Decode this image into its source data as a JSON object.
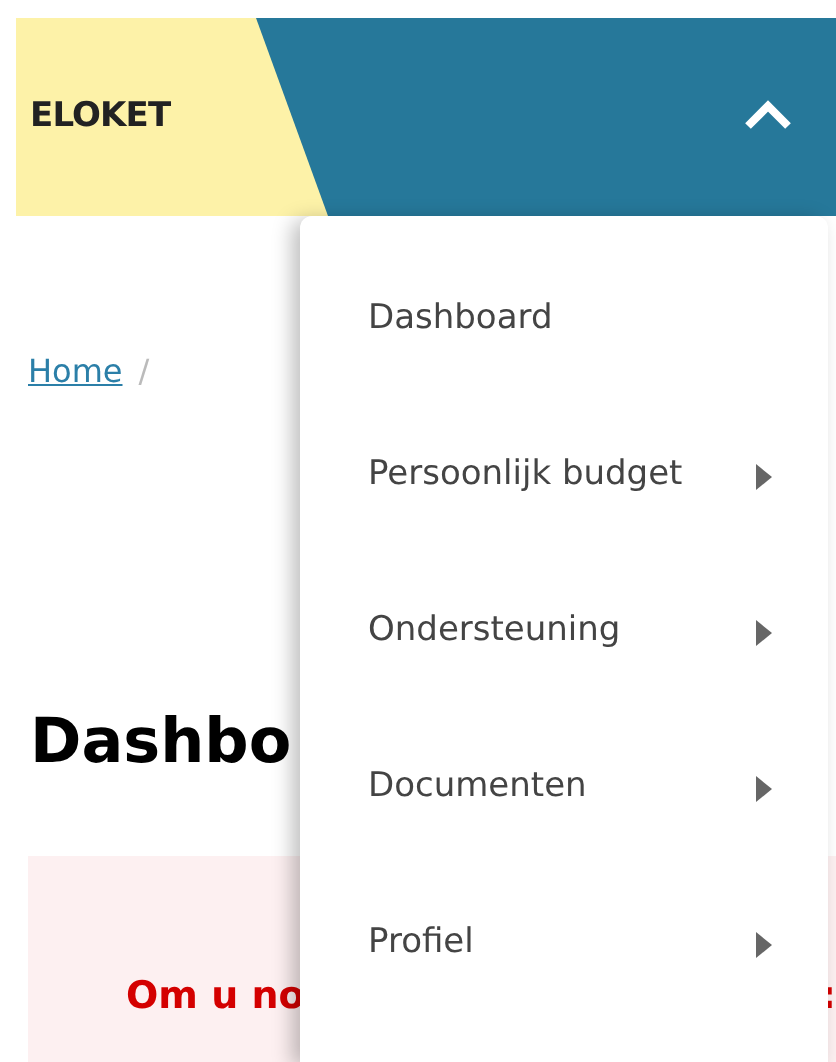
{
  "header": {
    "logo": "ELOKET",
    "menu_expanded": true
  },
  "breadcrumb": {
    "home": "Home",
    "separator": "/"
  },
  "heading": "Dashbo",
  "alert": {
    "text": "Om u no",
    "end": ":"
  },
  "menu": [
    {
      "label": "Dashboard",
      "has_submenu": false
    },
    {
      "label": "Persoonlijk budget",
      "has_submenu": true
    },
    {
      "label": "Ondersteuning",
      "has_submenu": true
    },
    {
      "label": "Documenten",
      "has_submenu": true
    },
    {
      "label": "Profiel",
      "has_submenu": true
    }
  ]
}
